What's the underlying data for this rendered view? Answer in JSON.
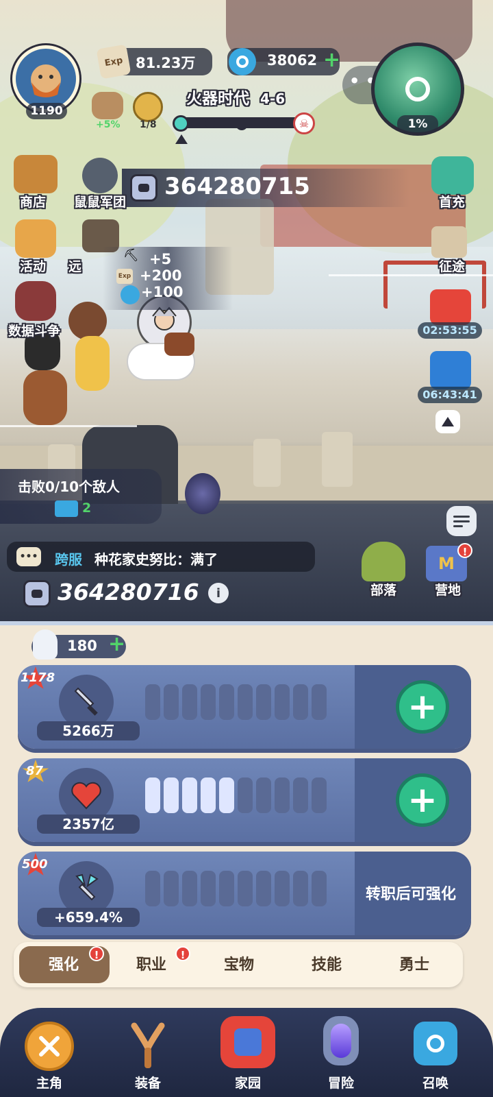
{
  "player": {
    "level": "1190"
  },
  "resources": {
    "exp": "81.23万",
    "gems": "38062",
    "gems_plus": "+"
  },
  "buffs": {
    "pet_bonus": "+5%",
    "token_progress": "1/8"
  },
  "stage": {
    "name": "火器时代",
    "number": "4-6"
  },
  "minimap": {
    "percent": "1%",
    "dots": "• •"
  },
  "power_banner": {
    "value": "364280715"
  },
  "left_menu": [
    {
      "label": "商店"
    },
    {
      "label": "鼠鼠军团"
    },
    {
      "label": "活动"
    },
    {
      "label": "远"
    },
    {
      "label": "数据斗争"
    }
  ],
  "right_menu": {
    "first_recharge": "首充",
    "expedition": "征途",
    "gift1_timer": "02:53:55",
    "gift2_timer": "06:43:41"
  },
  "rewards": {
    "a": "+5",
    "b": "+200",
    "c": "+100"
  },
  "quest": {
    "text": "击败0/10个敌人",
    "reward": "2"
  },
  "chat": {
    "channel": "跨服",
    "message": "种花家史努比：满了"
  },
  "bottom_right": {
    "tribe": "部落",
    "camp": "营地",
    "camp_badge": "!"
  },
  "power": {
    "value": "364280716",
    "info": "i"
  },
  "bulb": {
    "value": "180",
    "plus": "+"
  },
  "stats": [
    {
      "level": "1178",
      "value": "5266万",
      "icon": "sword-icon",
      "filled": 0,
      "segments": 10,
      "action": "+"
    },
    {
      "level": "87",
      "value": "2357亿",
      "icon": "heart-icon",
      "filled": 5,
      "segments": 10,
      "action": "+"
    },
    {
      "level": "500",
      "value": "+659.4%",
      "icon": "crystal-sword-icon",
      "filled": 0,
      "segments": 10,
      "locked_text": "转职后可强化"
    }
  ],
  "tabs": [
    {
      "label": "强化",
      "active": true,
      "badge": "!"
    },
    {
      "label": "职业",
      "active": false,
      "badge": "!"
    },
    {
      "label": "宝物",
      "active": false
    },
    {
      "label": "技能",
      "active": false
    },
    {
      "label": "勇士",
      "active": false
    }
  ],
  "bottom_nav": [
    {
      "label": "主角",
      "icon": "close-icon"
    },
    {
      "label": "装备",
      "icon": "slingshot-icon"
    },
    {
      "label": "家园",
      "icon": "castle-icon"
    },
    {
      "label": "冒险",
      "icon": "portal-icon"
    },
    {
      "label": "召唤",
      "icon": "summon-icon"
    }
  ],
  "colors": {
    "accent_green": "#2fbf8a",
    "card_blue": "#5b70a3",
    "tab_active": "#8a6a4e"
  }
}
